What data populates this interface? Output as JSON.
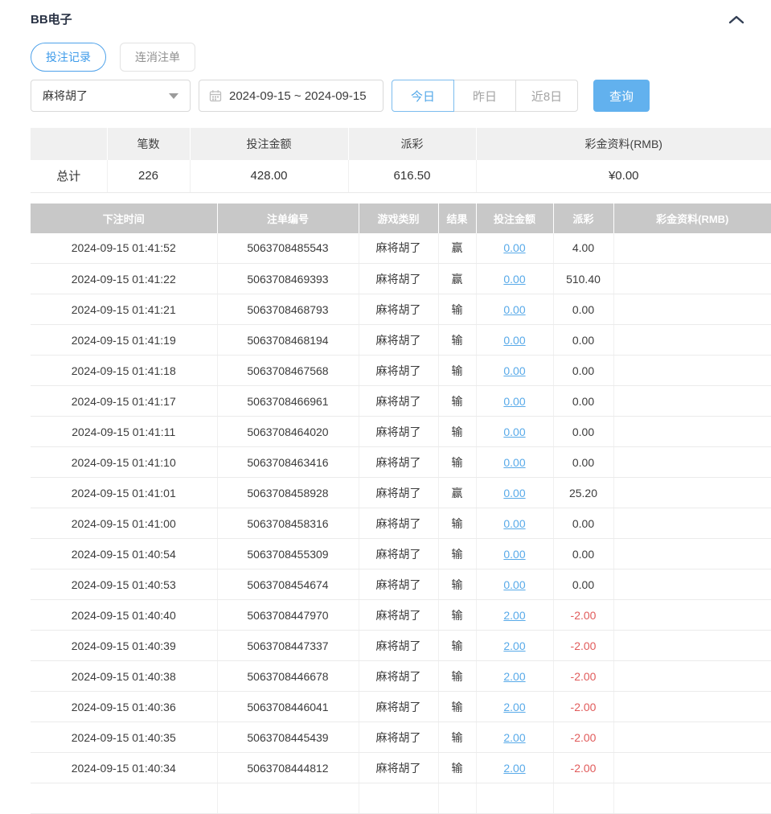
{
  "panel": {
    "title": "BB电子"
  },
  "tabs": [
    {
      "label": "投注记录",
      "active": true
    },
    {
      "label": "连消注单",
      "active": false
    }
  ],
  "filters": {
    "game_select": {
      "value": "麻将胡了",
      "icon": "caret-down-icon"
    },
    "date_range": {
      "value": "2024-09-15 ~ 2024-09-15",
      "icon": "calendar-icon"
    },
    "quick_ranges": [
      {
        "label": "今日",
        "active": true
      },
      {
        "label": "昨日",
        "active": false
      },
      {
        "label": "近8日",
        "active": false
      }
    ],
    "search_label": "查询"
  },
  "colors": {
    "accent_blue": "#4da1ea",
    "search_button": "#62b1ee",
    "link_blue": "#58aae9",
    "negative_red": "#e15b5b",
    "table_header_bg": "#c8c8c8",
    "summary_header_bg": "#f0f0f0"
  },
  "summary": {
    "headers": [
      "",
      "笔数",
      "投注金额",
      "派彩",
      "彩金资料(RMB)"
    ],
    "row_label": "总计",
    "count": "226",
    "bet_total": "428.00",
    "payout_total": "616.50",
    "bonus_total": "¥0.00"
  },
  "records": {
    "headers": [
      "下注时间",
      "注单编号",
      "游戏类别",
      "结果",
      "投注金额",
      "派彩",
      "彩金资料(RMB)"
    ],
    "rows": [
      {
        "time": "2024-09-15 01:41:52",
        "order_id": "5063708485543",
        "game": "麻将胡了",
        "result": "赢",
        "bet": "0.00",
        "payout": "4.00",
        "bonus": ""
      },
      {
        "time": "2024-09-15 01:41:22",
        "order_id": "5063708469393",
        "game": "麻将胡了",
        "result": "赢",
        "bet": "0.00",
        "payout": "510.40",
        "bonus": ""
      },
      {
        "time": "2024-09-15 01:41:21",
        "order_id": "5063708468793",
        "game": "麻将胡了",
        "result": "输",
        "bet": "0.00",
        "payout": "0.00",
        "bonus": ""
      },
      {
        "time": "2024-09-15 01:41:19",
        "order_id": "5063708468194",
        "game": "麻将胡了",
        "result": "输",
        "bet": "0.00",
        "payout": "0.00",
        "bonus": ""
      },
      {
        "time": "2024-09-15 01:41:18",
        "order_id": "5063708467568",
        "game": "麻将胡了",
        "result": "输",
        "bet": "0.00",
        "payout": "0.00",
        "bonus": ""
      },
      {
        "time": "2024-09-15 01:41:17",
        "order_id": "5063708466961",
        "game": "麻将胡了",
        "result": "输",
        "bet": "0.00",
        "payout": "0.00",
        "bonus": ""
      },
      {
        "time": "2024-09-15 01:41:11",
        "order_id": "5063708464020",
        "game": "麻将胡了",
        "result": "输",
        "bet": "0.00",
        "payout": "0.00",
        "bonus": ""
      },
      {
        "time": "2024-09-15 01:41:10",
        "order_id": "5063708463416",
        "game": "麻将胡了",
        "result": "输",
        "bet": "0.00",
        "payout": "0.00",
        "bonus": ""
      },
      {
        "time": "2024-09-15 01:41:01",
        "order_id": "5063708458928",
        "game": "麻将胡了",
        "result": "赢",
        "bet": "0.00",
        "payout": "25.20",
        "bonus": ""
      },
      {
        "time": "2024-09-15 01:41:00",
        "order_id": "5063708458316",
        "game": "麻将胡了",
        "result": "输",
        "bet": "0.00",
        "payout": "0.00",
        "bonus": ""
      },
      {
        "time": "2024-09-15 01:40:54",
        "order_id": "5063708455309",
        "game": "麻将胡了",
        "result": "输",
        "bet": "0.00",
        "payout": "0.00",
        "bonus": ""
      },
      {
        "time": "2024-09-15 01:40:53",
        "order_id": "5063708454674",
        "game": "麻将胡了",
        "result": "输",
        "bet": "0.00",
        "payout": "0.00",
        "bonus": ""
      },
      {
        "time": "2024-09-15 01:40:40",
        "order_id": "5063708447970",
        "game": "麻将胡了",
        "result": "输",
        "bet": "2.00",
        "payout": "-2.00",
        "bonus": ""
      },
      {
        "time": "2024-09-15 01:40:39",
        "order_id": "5063708447337",
        "game": "麻将胡了",
        "result": "输",
        "bet": "2.00",
        "payout": "-2.00",
        "bonus": ""
      },
      {
        "time": "2024-09-15 01:40:38",
        "order_id": "5063708446678",
        "game": "麻将胡了",
        "result": "输",
        "bet": "2.00",
        "payout": "-2.00",
        "bonus": ""
      },
      {
        "time": "2024-09-15 01:40:36",
        "order_id": "5063708446041",
        "game": "麻将胡了",
        "result": "输",
        "bet": "2.00",
        "payout": "-2.00",
        "bonus": ""
      },
      {
        "time": "2024-09-15 01:40:35",
        "order_id": "5063708445439",
        "game": "麻将胡了",
        "result": "输",
        "bet": "2.00",
        "payout": "-2.00",
        "bonus": ""
      },
      {
        "time": "2024-09-15 01:40:34",
        "order_id": "5063708444812",
        "game": "麻将胡了",
        "result": "输",
        "bet": "2.00",
        "payout": "-2.00",
        "bonus": ""
      }
    ]
  }
}
